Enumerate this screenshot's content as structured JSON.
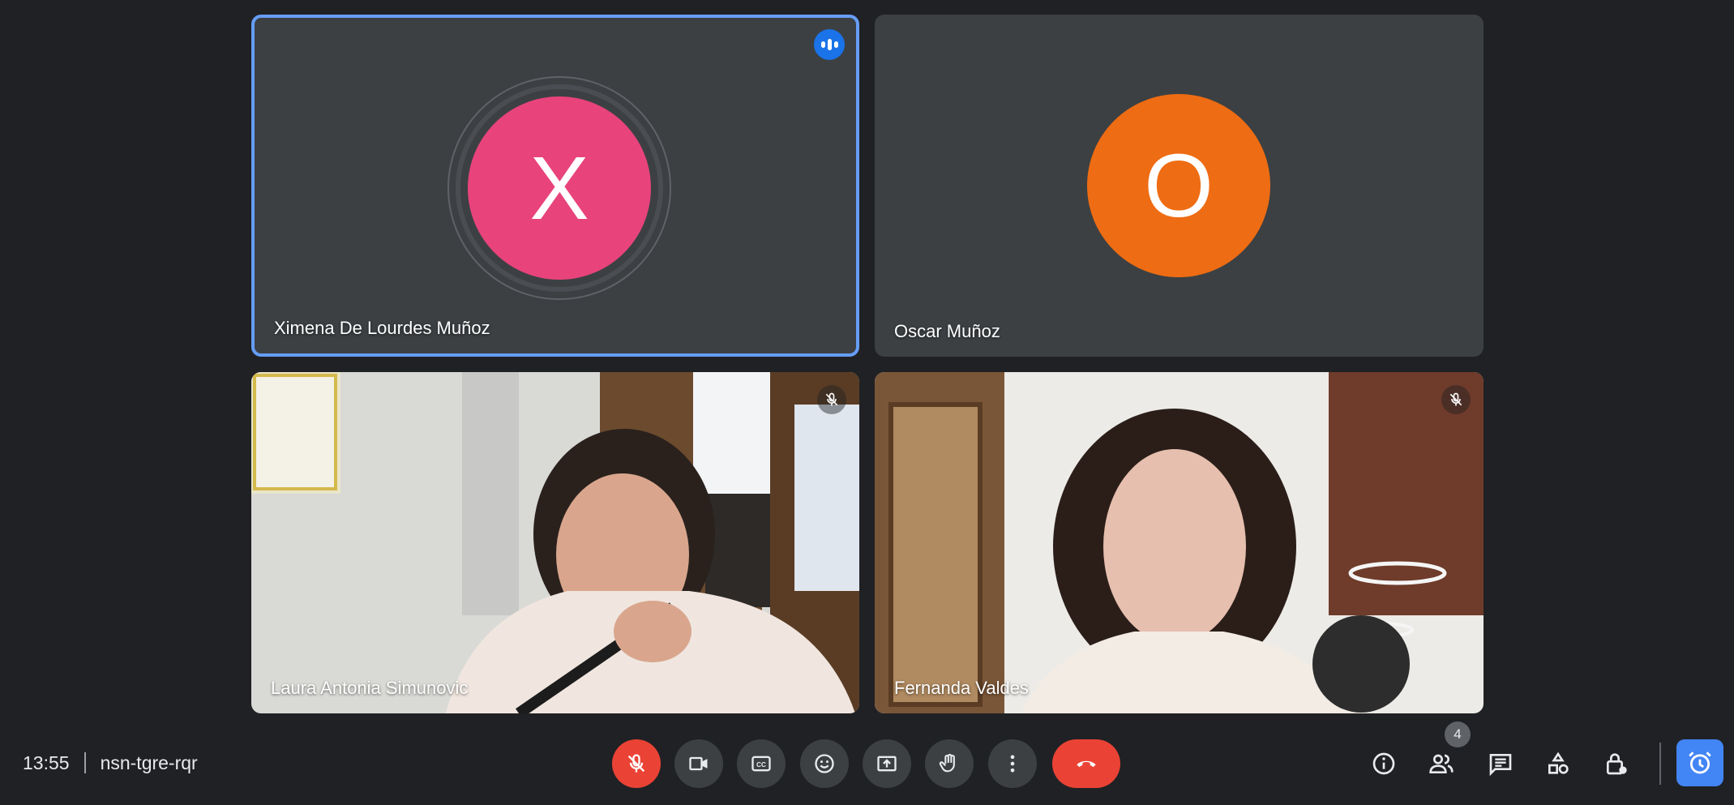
{
  "meeting": {
    "time": "13:55",
    "code": "nsn-tgre-rqr"
  },
  "participants": [
    {
      "name": "Ximena De Lourdes Muñoz",
      "initial": "X",
      "avatar_color": "#e8437b",
      "speaking": true
    },
    {
      "name": "Oscar Muñoz",
      "initial": "O",
      "avatar_color": "#ee6c13"
    },
    {
      "name": "Laura Antonia Simunovic",
      "muted": true
    },
    {
      "name": "Fernanda Valdes",
      "muted": true
    }
  ],
  "controls": [
    {
      "name": "microphone-off",
      "icon": "mic-off-icon",
      "state": "off"
    },
    {
      "name": "camera",
      "icon": "videocam-icon"
    },
    {
      "name": "captions",
      "icon": "closed-captions-icon"
    },
    {
      "name": "reactions",
      "icon": "emoji-icon"
    },
    {
      "name": "present",
      "icon": "present-screen-icon"
    },
    {
      "name": "raise-hand",
      "icon": "hand-icon"
    },
    {
      "name": "more-options",
      "icon": "more-vert-icon"
    },
    {
      "name": "leave-call",
      "icon": "call-end-icon"
    }
  ],
  "side_controls": {
    "people_count": "4",
    "icons": [
      "info-icon",
      "people-icon",
      "chat-icon",
      "activities-icon",
      "host-controls-icon",
      "alarm-icon"
    ]
  },
  "colors": {
    "background": "#202124",
    "tile": "#3c4043",
    "active_border": "#669df6",
    "danger": "#ea4335",
    "accent": "#4285f4"
  }
}
